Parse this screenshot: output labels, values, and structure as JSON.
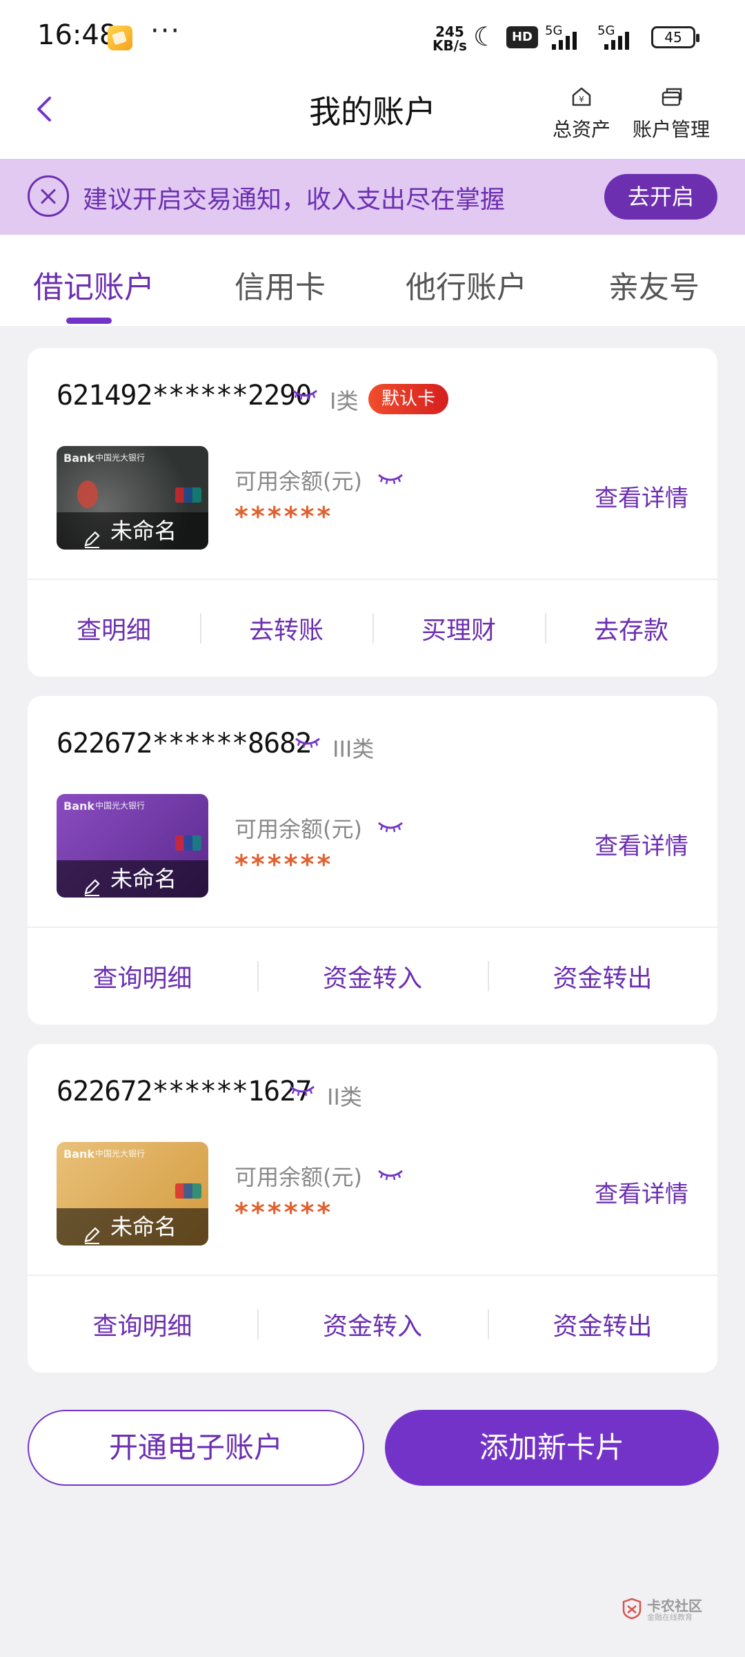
{
  "status_bar": {
    "time": "16:48",
    "dots": "···",
    "speed_value": "245",
    "speed_unit": "KB/s",
    "hd": "HD",
    "net1": "5G",
    "net2": "5G",
    "battery": "45"
  },
  "header": {
    "title": "我的账户",
    "total_assets": "总资产",
    "account_manage": "账户管理"
  },
  "notice": {
    "text": "建议开启交易通知，收入支出尽在掌握",
    "button": "去开启"
  },
  "tabs": [
    {
      "label": "借记账户",
      "active": true
    },
    {
      "label": "信用卡",
      "active": false
    },
    {
      "label": "他行账户",
      "active": false
    },
    {
      "label": "亲友号",
      "active": false
    }
  ],
  "accounts": [
    {
      "number": "621492******2290",
      "class": "I类",
      "default_badge": "默认卡",
      "card_name": "未命名",
      "bank_logo": "Bank",
      "bank_name": "中国光大银行",
      "balance_label": "可用余额(元)",
      "balance": "******",
      "detail": "查看详情",
      "actions": [
        "查明细",
        "去转账",
        "买理财",
        "去存款"
      ]
    },
    {
      "number": "622672******8682",
      "class": "III类",
      "card_name": "未命名",
      "bank_logo": "Bank",
      "bank_name": "中国光大银行",
      "balance_label": "可用余额(元)",
      "balance": "******",
      "detail": "查看详情",
      "actions": [
        "查询明细",
        "资金转入",
        "资金转出"
      ]
    },
    {
      "number": "622672******1627",
      "class": "II类",
      "card_name": "未命名",
      "bank_logo": "Bank",
      "bank_name": "中国光大银行",
      "balance_label": "可用余额(元)",
      "balance": "******",
      "detail": "查看详情",
      "actions": [
        "查询明细",
        "资金转入",
        "资金转出"
      ]
    }
  ],
  "bottom": {
    "open_e_account": "开通电子账户",
    "add_card": "添加新卡片"
  },
  "watermark": {
    "title": "卡农社区",
    "subtitle": "金融在线教育"
  },
  "colors": {
    "brand": "#7433c8",
    "brand_text": "#6b2fb0",
    "notice_bg": "#e2c9f2",
    "balance": "#e0612f",
    "badge": "#e0321f"
  }
}
